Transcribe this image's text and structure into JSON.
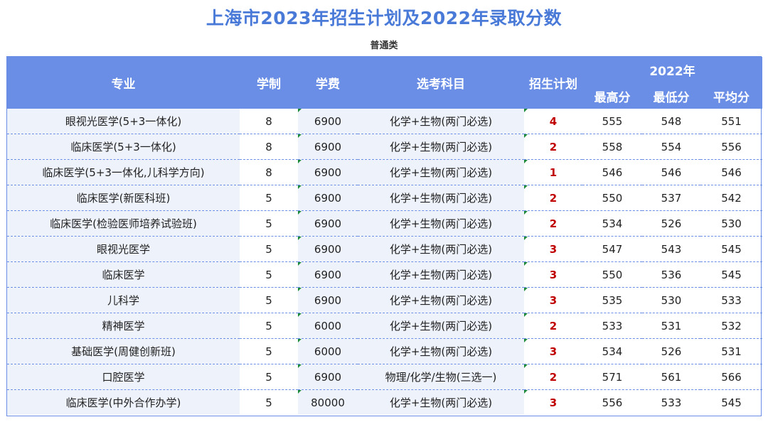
{
  "title": "上海市2023年招生计划及2022年录取分数",
  "subtitle": "普通类",
  "headers": {
    "major": "专业",
    "years": "学制",
    "fee": "学费",
    "subjects": "选考科目",
    "plan": "招生计划",
    "group": "2022年",
    "max": "最高分",
    "min": "最低分",
    "avg": "平均分"
  },
  "rows": [
    {
      "major": "眼视光医学(5+3一体化)",
      "years": "8",
      "fee": "6900",
      "subjects": "化学+生物(两门必选)",
      "plan": "4",
      "max": "555",
      "min": "548",
      "avg": "551"
    },
    {
      "major": "临床医学(5+3一体化)",
      "years": "8",
      "fee": "6900",
      "subjects": "化学+生物(两门必选)",
      "plan": "2",
      "max": "558",
      "min": "554",
      "avg": "556"
    },
    {
      "major": "临床医学(5+3一体化,儿科学方向)",
      "years": "8",
      "fee": "6900",
      "subjects": "化学+生物(两门必选)",
      "plan": "1",
      "max": "546",
      "min": "546",
      "avg": "546"
    },
    {
      "major": "临床医学(新医科班)",
      "years": "5",
      "fee": "6900",
      "subjects": "化学+生物(两门必选)",
      "plan": "2",
      "max": "550",
      "min": "537",
      "avg": "542"
    },
    {
      "major": "临床医学(检验医师培养试验班)",
      "years": "5",
      "fee": "6900",
      "subjects": "化学+生物(两门必选)",
      "plan": "2",
      "max": "534",
      "min": "526",
      "avg": "530"
    },
    {
      "major": "眼视光医学",
      "years": "5",
      "fee": "6900",
      "subjects": "化学+生物(两门必选)",
      "plan": "3",
      "max": "547",
      "min": "543",
      "avg": "545"
    },
    {
      "major": "临床医学",
      "years": "5",
      "fee": "6900",
      "subjects": "化学+生物(两门必选)",
      "plan": "3",
      "max": "550",
      "min": "536",
      "avg": "545"
    },
    {
      "major": "儿科学",
      "years": "5",
      "fee": "6900",
      "subjects": "化学+生物(两门必选)",
      "plan": "3",
      "max": "535",
      "min": "530",
      "avg": "533"
    },
    {
      "major": "精神医学",
      "years": "5",
      "fee": "6000",
      "subjects": "化学+生物(两门必选)",
      "plan": "2",
      "max": "533",
      "min": "531",
      "avg": "532"
    },
    {
      "major": "基础医学(周健创新班)",
      "years": "5",
      "fee": "6000",
      "subjects": "化学+生物(两门必选)",
      "plan": "3",
      "max": "534",
      "min": "526",
      "avg": "531"
    },
    {
      "major": "口腔医学",
      "years": "5",
      "fee": "6900",
      "subjects": "物理/化学/生物(三选一)",
      "plan": "2",
      "max": "571",
      "min": "561",
      "avg": "566"
    },
    {
      "major": "临床医学(中外合作办学)",
      "years": "5",
      "fee": "80000",
      "subjects": "化学+生物(两门必选)",
      "plan": "3",
      "max": "556",
      "min": "533",
      "avg": "545"
    }
  ]
}
